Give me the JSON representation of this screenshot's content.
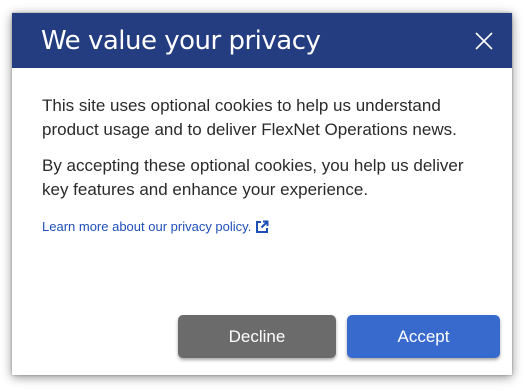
{
  "dialog": {
    "title": "We value your privacy",
    "paragraph1": "This site uses optional cookies to help us understand product usage and to deliver FlexNet Operations news.",
    "paragraph2": "By accepting these optional cookies, you help us deliver key features and enhance your experience.",
    "link_text": "Learn more about our privacy policy.",
    "decline_label": "Decline",
    "accept_label": "Accept"
  },
  "icons": {
    "close": "close-icon",
    "external_link": "external-link-icon"
  },
  "colors": {
    "header_bg": "#243c80",
    "decline_bg": "#6b6b6b",
    "accept_bg": "#3869cc",
    "link": "#1f4fb8"
  }
}
